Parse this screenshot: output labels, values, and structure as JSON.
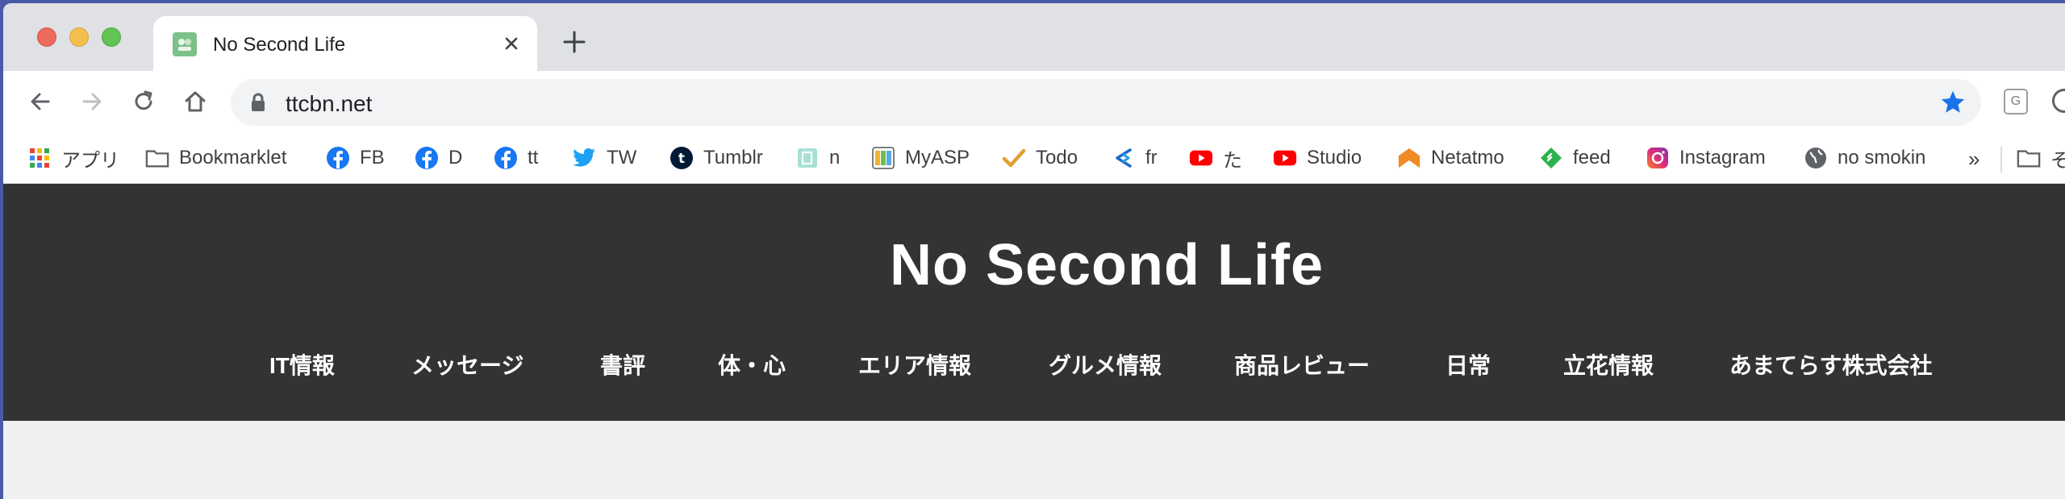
{
  "browser": {
    "tab": {
      "title": "No Second Life",
      "close_icon": "close-icon"
    },
    "new_tab_icon": "plus-icon",
    "url": "ttcbn.net",
    "toolbar_icons": [
      "back-arrow-icon",
      "forward-arrow-icon",
      "reload-icon",
      "home-icon",
      "lock-icon",
      "star-icon"
    ],
    "extension_label": "G"
  },
  "bookmarks": {
    "items": [
      {
        "label": "アプリ",
        "icon": "apps-grid-icon"
      },
      {
        "label": "Bookmarklet",
        "icon": "folder-icon"
      },
      {
        "label": "FB",
        "icon": "facebook-icon"
      },
      {
        "label": "D",
        "icon": "facebook-icon"
      },
      {
        "label": "tt",
        "icon": "facebook-icon"
      },
      {
        "label": "TW",
        "icon": "twitter-icon"
      },
      {
        "label": "Tumblr",
        "icon": "tumblr-icon"
      },
      {
        "label": "n",
        "icon": "note-icon"
      },
      {
        "label": "MyASP",
        "icon": "myasp-icon"
      },
      {
        "label": "Todo",
        "icon": "checkmark-icon"
      },
      {
        "label": "fr",
        "icon": "arrow-logo-icon"
      },
      {
        "label": "た",
        "icon": "youtube-icon"
      },
      {
        "label": "Studio",
        "icon": "youtube-icon"
      },
      {
        "label": "Netatmo",
        "icon": "netatmo-icon"
      },
      {
        "label": "feed",
        "icon": "feedly-icon"
      },
      {
        "label": "Instagram",
        "icon": "instagram-icon"
      },
      {
        "label": "no smokin",
        "icon": "globe-icon"
      }
    ],
    "more": "»",
    "trailing_folder_label": "そ"
  },
  "site": {
    "title": "No Second Life",
    "nav": [
      "IT情報",
      "メッセージ",
      "書評",
      "体・心",
      "エリア情報",
      "グルメ情報",
      "商品レビュー",
      "日常",
      "立花情報",
      "あまてらす株式会社"
    ]
  },
  "colors": {
    "header_bg": "#333333",
    "page_bg": "#f0f0f0",
    "star": "#1a73e8"
  }
}
